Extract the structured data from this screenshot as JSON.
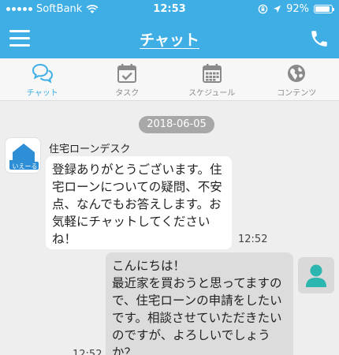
{
  "status_bar": {
    "carrier": "SoftBank",
    "time": "12:53",
    "battery_percent_label": "92%",
    "battery_level": 0.92
  },
  "header": {
    "title": "チャット",
    "menu_icon": "hamburger-menu-icon",
    "phone_icon": "phone-icon"
  },
  "tabs": [
    {
      "label": "チャット",
      "icon": "chat-bubbles-icon",
      "active": true
    },
    {
      "label": "タスク",
      "icon": "calendar-check-icon",
      "active": false
    },
    {
      "label": "スケジュール",
      "icon": "calendar-grid-icon",
      "active": false
    },
    {
      "label": "コンテンツ",
      "icon": "globe-icon",
      "active": false
    }
  ],
  "chat": {
    "date": "2018-06-05",
    "messages": [
      {
        "direction": "incoming",
        "sender": "住宅ローンデスク",
        "avatar_text": "いえーる",
        "text": "登録ありがとうございます。住宅ローンについての疑問、不安点、なんでもお答えします。お気軽にチャットしてくださいね！",
        "time": "12:52"
      },
      {
        "direction": "outgoing",
        "text": "こんにちは！\n最近家を買おうと思ってますので、住宅ローンの申請をしたいです。相談させていただきたいのですが、よろしいでしょうか？",
        "time": "12:52"
      }
    ]
  },
  "colors": {
    "brand_blue": "#3eaee4",
    "user_avatar_teal": "#2bb6b0"
  }
}
